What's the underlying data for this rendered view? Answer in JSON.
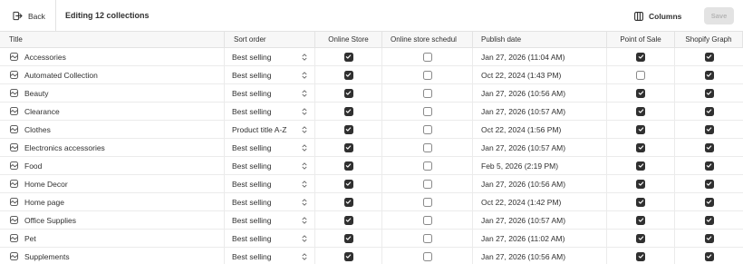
{
  "header": {
    "back_label": "Back",
    "title": "Editing 12 collections",
    "columns_label": "Columns",
    "save_label": "Save"
  },
  "columns": {
    "title": "Title",
    "sort_order": "Sort order",
    "online_store": "Online Store",
    "online_store_schedule": "Online store schedul",
    "publish_date": "Publish date",
    "point_of_sale": "Point of Sale",
    "shopify_graph": "Shopify Graph"
  },
  "rows": [
    {
      "title": "Accessories",
      "sort": "Best selling",
      "online": true,
      "sched": false,
      "pub": "Jan 27, 2026 (11:04 AM)",
      "pos": true,
      "graph": true
    },
    {
      "title": "Automated Collection",
      "sort": "Best selling",
      "online": true,
      "sched": false,
      "pub": "Oct 22, 2024 (1:43 PM)",
      "pos": false,
      "graph": true
    },
    {
      "title": "Beauty",
      "sort": "Best selling",
      "online": true,
      "sched": false,
      "pub": "Jan 27, 2026 (10:56 AM)",
      "pos": true,
      "graph": true
    },
    {
      "title": "Clearance",
      "sort": "Best selling",
      "online": true,
      "sched": false,
      "pub": "Jan 27, 2026 (10:57 AM)",
      "pos": true,
      "graph": true
    },
    {
      "title": "Clothes",
      "sort": "Product title A-Z",
      "online": true,
      "sched": false,
      "pub": "Oct 22, 2024 (1:56 PM)",
      "pos": true,
      "graph": true
    },
    {
      "title": "Electronics accessories",
      "sort": "Best selling",
      "online": true,
      "sched": false,
      "pub": "Jan 27, 2026 (10:57 AM)",
      "pos": true,
      "graph": true
    },
    {
      "title": "Food",
      "sort": "Best selling",
      "online": true,
      "sched": false,
      "pub": "Feb 5, 2026 (2:19 PM)",
      "pos": true,
      "graph": true
    },
    {
      "title": "Home Decor",
      "sort": "Best selling",
      "online": true,
      "sched": false,
      "pub": "Jan 27, 2026 (10:56 AM)",
      "pos": true,
      "graph": true
    },
    {
      "title": "Home page",
      "sort": "Best selling",
      "online": true,
      "sched": false,
      "pub": "Oct 22, 2024 (1:42 PM)",
      "pos": true,
      "graph": true
    },
    {
      "title": "Office Supplies",
      "sort": "Best selling",
      "online": true,
      "sched": false,
      "pub": "Jan 27, 2026 (10:57 AM)",
      "pos": true,
      "graph": true
    },
    {
      "title": "Pet",
      "sort": "Best selling",
      "online": true,
      "sched": false,
      "pub": "Jan 27, 2026 (11:02 AM)",
      "pos": true,
      "graph": true
    },
    {
      "title": "Supplements",
      "sort": "Best selling",
      "online": true,
      "sched": false,
      "pub": "Jan 27, 2026 (10:56 AM)",
      "pos": true,
      "graph": true
    }
  ],
  "icons": {
    "back": "back-arrow-icon",
    "columns": "columns-icon",
    "collection": "collection-icon",
    "select": "select-chevron-icon",
    "check": "checkmark-icon"
  },
  "colors": {
    "checked": "#303030",
    "header_bg": "#f7f7f7",
    "save_disabled_bg": "#e3e3e3",
    "save_disabled_text": "#b5b5b5"
  }
}
